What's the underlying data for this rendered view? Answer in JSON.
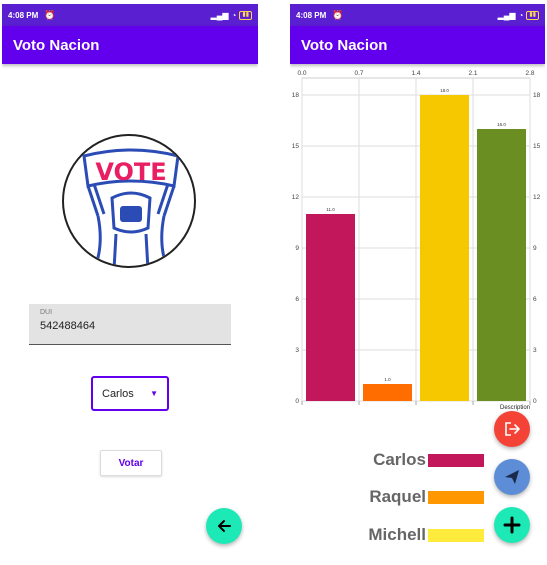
{
  "status": {
    "time": "4:08 PM"
  },
  "app_title": "Voto Nacion",
  "left": {
    "vote_label": "VOTE",
    "dui_label": "DUI",
    "dui_value": "542488464",
    "selected_candidate": "Carlos",
    "vote_button": "Votar"
  },
  "right": {
    "legend": [
      {
        "name": "Carlos",
        "color": "#c2185b"
      },
      {
        "name": "Raquel",
        "color": "#ff9800"
      },
      {
        "name": "Michell",
        "color": "#ffeb3b"
      }
    ],
    "fab_colors": {
      "logout": "#f44336",
      "send": "#5c8dd6",
      "add": "#1de9b6"
    }
  },
  "chart_data": {
    "type": "bar",
    "x_top_ticks": [
      "0.0",
      "0.7",
      "1.4",
      "2.1",
      "2.8"
    ],
    "y_ticks": [
      "0",
      "3",
      "6",
      "9",
      "12",
      "15",
      "18"
    ],
    "ylim": [
      0,
      19
    ],
    "bar_labels": [
      "11.0",
      "1.0",
      "18.0",
      "16.0"
    ],
    "values": [
      11,
      1,
      18,
      16
    ],
    "colors": [
      "#c2185b",
      "#ff6d00",
      "#f5c800",
      "#6b8e23"
    ],
    "description": "Description"
  }
}
